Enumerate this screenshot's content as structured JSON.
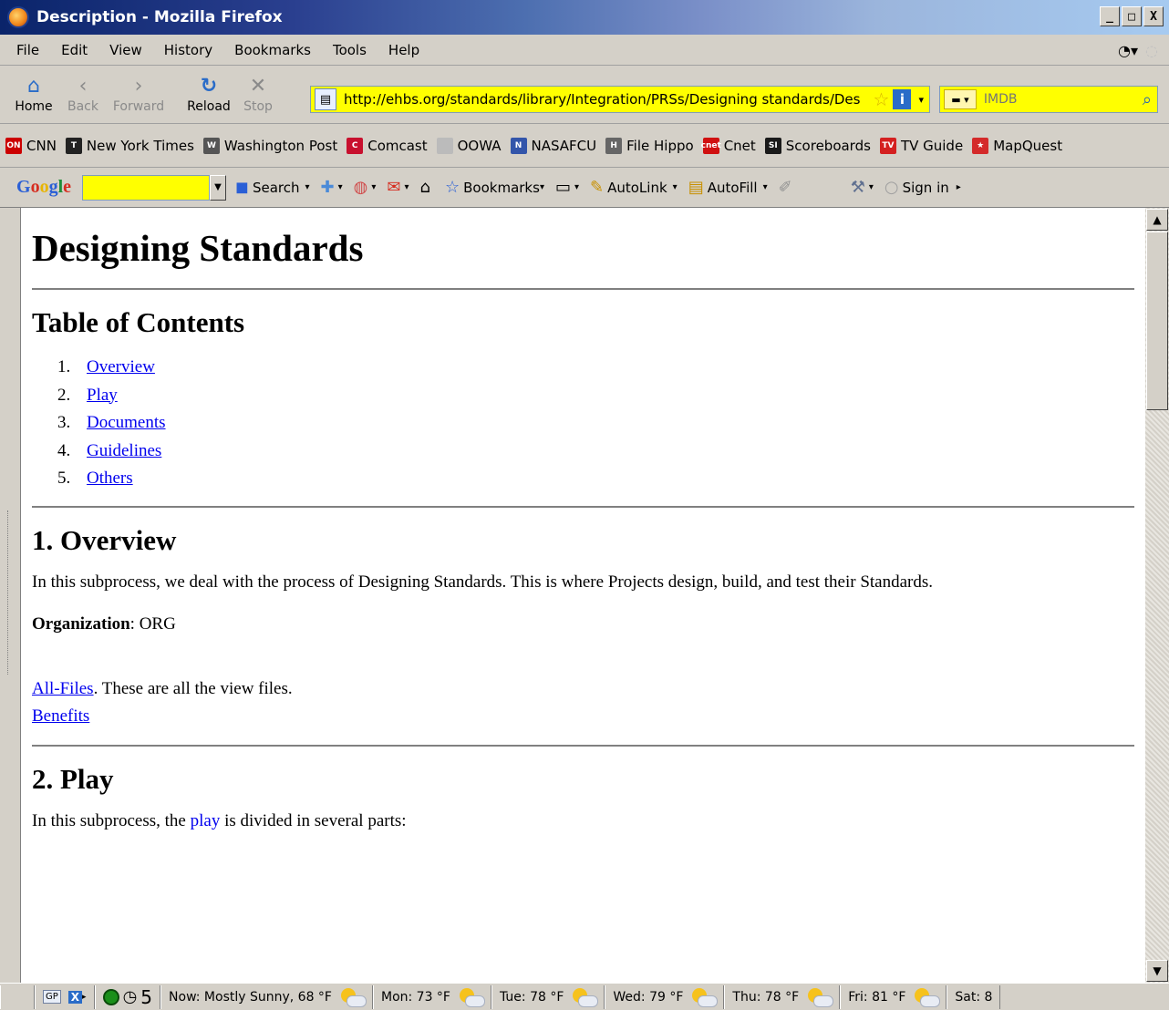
{
  "window": {
    "title": "Description - Mozilla Firefox",
    "controls": [
      "_",
      "□",
      "X"
    ]
  },
  "menubar": {
    "items": [
      "File",
      "Edit",
      "View",
      "History",
      "Bookmarks",
      "Tools",
      "Help"
    ]
  },
  "navbar": {
    "home": "Home",
    "back": "Back",
    "forward": "Forward",
    "reload": "Reload",
    "stop": "Stop",
    "url": "http://ehbs.org/standards/library/Integration/PRSs/Designing standards/Des",
    "search_engine": "IMDB",
    "search_placeholder": "IMDB"
  },
  "bookmarks": [
    {
      "label": "CNN",
      "icon": "cnn-icon",
      "color": "#cc0000",
      "glyph": "ON"
    },
    {
      "label": "New York Times",
      "icon": "nyt-icon",
      "color": "#222222",
      "glyph": "T"
    },
    {
      "label": "Washington Post",
      "icon": "wapo-icon",
      "color": "#555555",
      "glyph": "W"
    },
    {
      "label": "Comcast",
      "icon": "comcast-icon",
      "color": "#c8102e",
      "glyph": "C"
    },
    {
      "label": "OOWA",
      "icon": "page-icon",
      "color": "#bbbbbb",
      "glyph": ""
    },
    {
      "label": "NASAFCU",
      "icon": "nasa-icon",
      "color": "#3355aa",
      "glyph": "N"
    },
    {
      "label": "File Hippo",
      "icon": "hippo-icon",
      "color": "#666666",
      "glyph": "H"
    },
    {
      "label": "Cnet",
      "icon": "cnet-icon",
      "color": "#d01010",
      "glyph": "cnet"
    },
    {
      "label": "Scoreboards",
      "icon": "si-icon",
      "color": "#1a1a1a",
      "glyph": "SI"
    },
    {
      "label": "TV Guide",
      "icon": "tvguide-icon",
      "color": "#d42020",
      "glyph": "TV"
    },
    {
      "label": "MapQuest",
      "icon": "mapquest-icon",
      "color": "#d42a2a",
      "glyph": "★"
    }
  ],
  "google_toolbar": {
    "logo": [
      "G",
      "o",
      "o",
      "g",
      "l",
      "e"
    ],
    "search": "Search",
    "bookmarks": "Bookmarks",
    "autolink": "AutoLink",
    "autofill": "AutoFill",
    "signin": "Sign in"
  },
  "page": {
    "title": "Designing Standards",
    "toc_heading": "Table of Contents",
    "toc": [
      {
        "num": "1.",
        "label": "Overview"
      },
      {
        "num": "2.",
        "label": "Play"
      },
      {
        "num": "3.",
        "label": "Documents"
      },
      {
        "num": "4.",
        "label": "Guidelines"
      },
      {
        "num": "5.",
        "label": "Others"
      }
    ],
    "overview": {
      "heading": "1. Overview",
      "text": "In this subprocess, we deal with the process of Designing Standards. This is where Projects design, build, and test their Standards.",
      "org_label": "Organization",
      "org_value": ": ORG",
      "all_files_link": "All-Files",
      "all_files_text": ". These are all the view files.",
      "benefits_link": "Benefits"
    },
    "play": {
      "heading": "2. Play",
      "text_before": "In this subprocess, the ",
      "link": "play",
      "text_after": " is divided in several parts:"
    }
  },
  "statusbar": {
    "gp": "GP",
    "counter": "5",
    "weather": [
      "Now: Mostly Sunny, 68 °F",
      "Mon: 73 °F",
      "Tue: 78 °F",
      "Wed: 79 °F",
      "Thu: 78 °F",
      "Fri: 81 °F",
      "Sat: 8"
    ]
  }
}
